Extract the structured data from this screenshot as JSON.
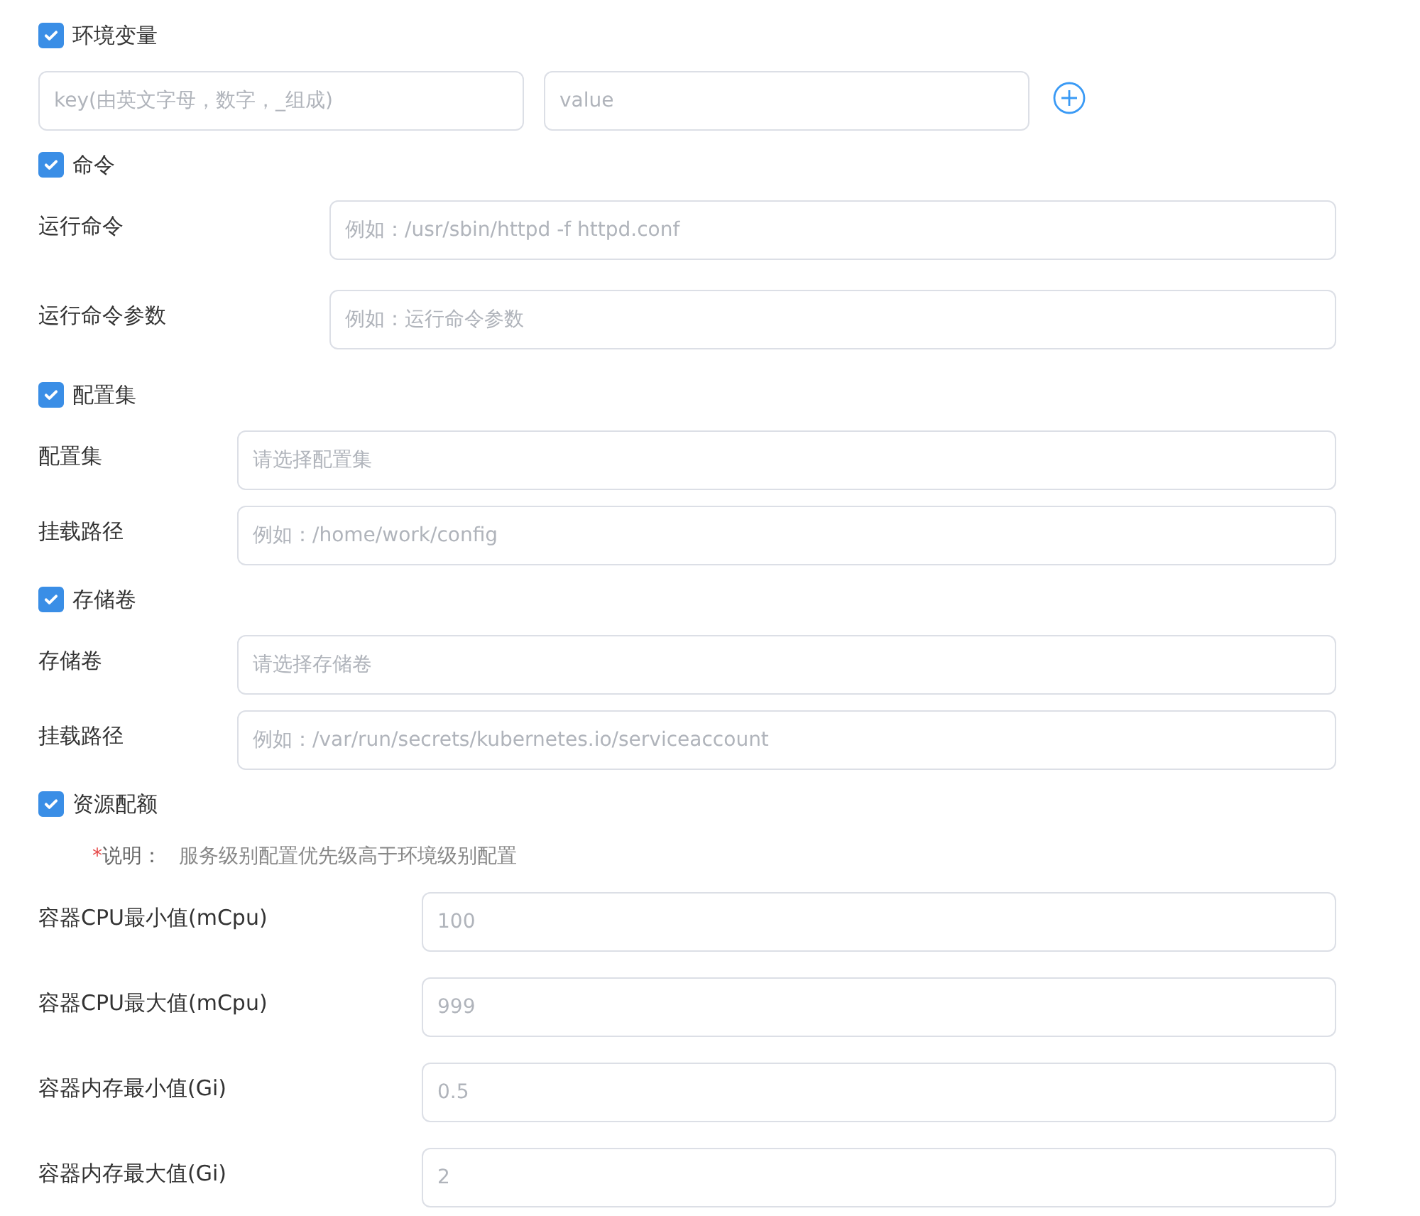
{
  "sections": [
    {
      "kind": "env",
      "title": "环境变量",
      "checked": true,
      "fields": [
        {
          "placeholder": "key(由英文字母，数字，_组成)"
        },
        {
          "placeholder": "value"
        }
      ]
    },
    {
      "kind": "command",
      "title": "命令",
      "checked": true,
      "fields": [
        {
          "label": "运行命令",
          "placeholder": "例如：/usr/sbin/httpd -f httpd.conf"
        },
        {
          "label": "运行命令参数",
          "placeholder": "例如：运行命令参数"
        }
      ]
    },
    {
      "kind": "config",
      "title": "配置集",
      "checked": true,
      "fields": [
        {
          "label": "配置集",
          "placeholder": "请选择配置集"
        },
        {
          "label": "挂载路径",
          "placeholder": "例如：/home/work/config"
        }
      ]
    },
    {
      "kind": "volume",
      "title": "存储卷",
      "checked": true,
      "fields": [
        {
          "label": "存储卷",
          "placeholder": "请选择存储卷"
        },
        {
          "label": "挂载路径",
          "placeholder": "例如：/var/run/secrets/kubernetes.io/serviceaccount"
        }
      ]
    },
    {
      "kind": "resource",
      "title": "资源配额",
      "checked": true,
      "note": {
        "mark": "*",
        "label": "说明：",
        "text": "服务级别配置优先级高于环境级别配置"
      },
      "fields": [
        {
          "label": "容器CPU最小值(mCpu)",
          "placeholder": "100"
        },
        {
          "label": "容器CPU最大值(mCpu)",
          "placeholder": "999"
        },
        {
          "label": "容器内存最小值(Gi)",
          "placeholder": "0.5"
        },
        {
          "label": "容器内存最大值(Gi)",
          "placeholder": "2"
        }
      ]
    }
  ]
}
